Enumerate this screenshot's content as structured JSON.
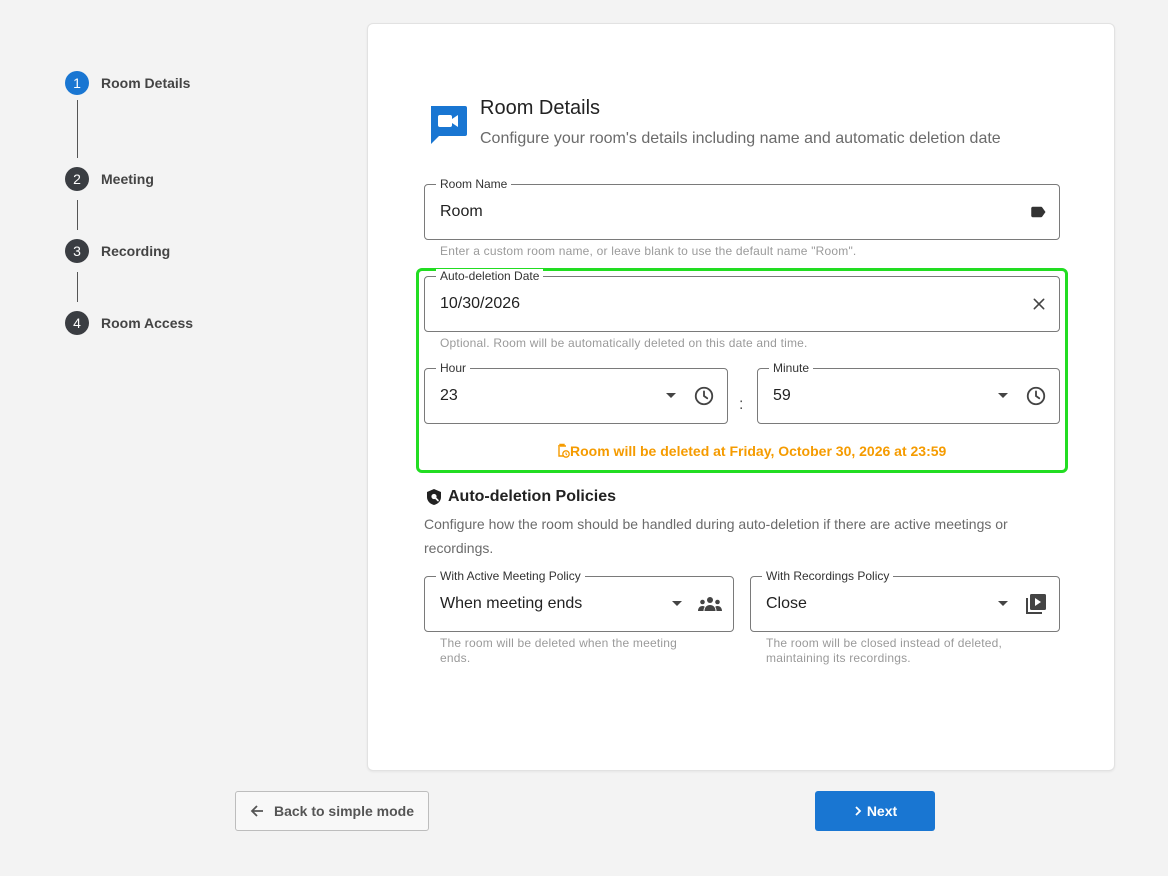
{
  "stepper": {
    "steps": [
      {
        "num": "1",
        "label": "Room Details"
      },
      {
        "num": "2",
        "label": "Meeting"
      },
      {
        "num": "3",
        "label": "Recording"
      },
      {
        "num": "4",
        "label": "Room Access"
      }
    ]
  },
  "card": {
    "title": "Room Details",
    "subtitle": "Configure your room's details including name and automatic deletion date",
    "room_name": {
      "label": "Room Name",
      "value": "Room",
      "hint": "Enter a custom room name, or leave blank to use the default name \"Room\"."
    },
    "auto_deletion_date": {
      "label": "Auto-deletion Date",
      "value": "10/30/2026",
      "hint": "Optional. Room will be automatically deleted on this date and time."
    },
    "hour": {
      "label": "Hour",
      "value": "23"
    },
    "minute": {
      "label": "Minute",
      "value": "59"
    },
    "separator": ":",
    "warning": "Room will be deleted at Friday, October 30, 2026 at 23:59",
    "policies": {
      "title": "Auto-deletion Policies",
      "description": "Configure how the room should be handled during auto-deletion if there are active meetings or recordings.",
      "meeting_policy": {
        "label": "With Active Meeting Policy",
        "value": "When meeting ends",
        "hint": "The room will be deleted when the meeting ends."
      },
      "recordings_policy": {
        "label": "With Recordings Policy",
        "value": "Close",
        "hint": "The room will be closed instead of deleted, maintaining its recordings."
      }
    }
  },
  "footer": {
    "back_label": "Back to simple mode",
    "next_label": "Next"
  },
  "colors": {
    "primary": "#1976d2",
    "warning": "#f59b00",
    "highlight": "#22dd22"
  }
}
